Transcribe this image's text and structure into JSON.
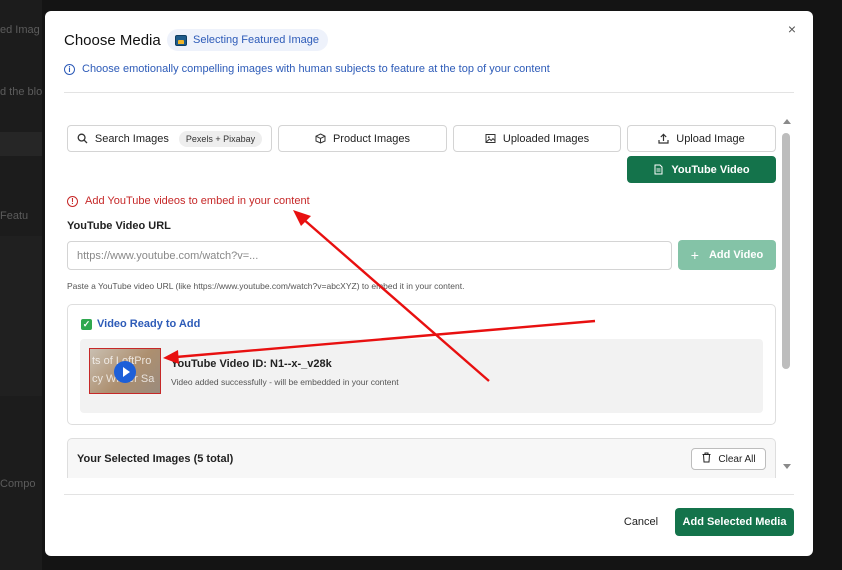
{
  "background": {
    "fragments": [
      "ed Imag",
      "d the blo",
      "Featu",
      "Compo"
    ]
  },
  "modal": {
    "title": "Choose Media",
    "featured_pill": "Selecting Featured Image",
    "info_text": "Choose emotionally compelling images with human subjects to feature at the top of your content",
    "close_icon": "close-icon"
  },
  "tabs": [
    {
      "label": "Search Images",
      "badge": "Pexels + Pixabay",
      "icon": "search-icon",
      "active": false
    },
    {
      "label": "Product Images",
      "icon": "box-icon",
      "active": false
    },
    {
      "label": "Uploaded Images",
      "icon": "image-icon",
      "active": false
    },
    {
      "label": "Upload Image",
      "icon": "upload-icon",
      "active": false
    },
    {
      "label": "YouTube Video",
      "icon": "document-icon",
      "active": true
    }
  ],
  "youtube": {
    "error_text": "Add YouTube videos to embed in your content",
    "field_label": "YouTube Video URL",
    "input_value": "",
    "input_placeholder": "https://www.youtube.com/watch?v=...",
    "add_button": "Add Video",
    "help_text": "Paste a YouTube video URL (like https://www.youtube.com/watch?v=abcXYZ) to embed it in your content."
  },
  "ready": {
    "title": "Video Ready to Add",
    "thumb_text_1": "ts of LoftPro",
    "thumb_text_2": "cy Winter Sa",
    "video_id": "YouTube Video ID: N1--x-_v28k",
    "video_sub": "Video added successfully - will be embedded in your content"
  },
  "selected": {
    "title": "Your Selected Images (5 total)",
    "clear_button": "Clear All"
  },
  "footer": {
    "cancel": "Cancel",
    "add_selected": "Add Selected Media"
  },
  "colors": {
    "accent_green": "#14734b",
    "disabled_green": "#84c3a7",
    "link_blue": "#2d5bb8",
    "error_red": "#c62828",
    "annotation_red": "#e81010"
  }
}
